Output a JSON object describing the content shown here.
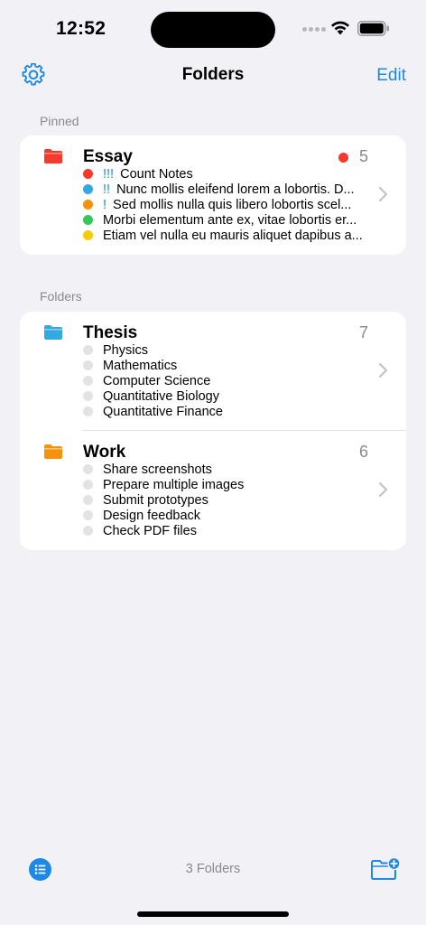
{
  "status": {
    "time": "12:52"
  },
  "nav": {
    "title": "Folders",
    "edit_label": "Edit"
  },
  "sections": {
    "pinned_label": "Pinned",
    "folders_label": "Folders"
  },
  "colors": {
    "accent": "#1E88E5",
    "red": "#F5392C",
    "blue": "#33A9E0",
    "orange": "#F5930F",
    "green": "#34C759",
    "yellow": "#F6CC0A",
    "empty_dot": "#E3E3E6"
  },
  "pinned": {
    "name": "Essay",
    "count": "5",
    "icon_color": "#F5392C",
    "items": [
      {
        "priority": "!!!",
        "text": "Count Notes",
        "color": "#F5392C"
      },
      {
        "priority": "!!",
        "text": "Nunc mollis eleifend lorem a lobortis. D...",
        "color": "#33A9E0"
      },
      {
        "priority": "!",
        "text": "Sed mollis nulla quis libero lobortis scel...",
        "color": "#F5930F"
      },
      {
        "priority": "",
        "text": "Morbi elementum ante ex, vitae lobortis er...",
        "color": "#34C759"
      },
      {
        "priority": "",
        "text": "Etiam vel nulla eu mauris aliquet dapibus a...",
        "color": "#F6CC0A"
      }
    ]
  },
  "folders": [
    {
      "name": "Thesis",
      "count": "7",
      "icon_color": "#33A9E0",
      "items": [
        {
          "priority": "",
          "text": "Physics",
          "color": "#E3E3E6"
        },
        {
          "priority": "",
          "text": "Mathematics",
          "color": "#E3E3E6"
        },
        {
          "priority": "",
          "text": "Computer Science",
          "color": "#E3E3E6"
        },
        {
          "priority": "",
          "text": "Quantitative Biology",
          "color": "#E3E3E6"
        },
        {
          "priority": "",
          "text": "Quantitative Finance",
          "color": "#E3E3E6"
        }
      ]
    },
    {
      "name": "Work",
      "count": "6",
      "icon_color": "#F5930F",
      "items": [
        {
          "priority": "",
          "text": "Share screenshots",
          "color": "#E3E3E6"
        },
        {
          "priority": "",
          "text": "Prepare multiple images",
          "color": "#E3E3E6"
        },
        {
          "priority": "",
          "text": "Submit prototypes",
          "color": "#E3E3E6"
        },
        {
          "priority": "",
          "text": "Design feedback",
          "color": "#E3E3E6"
        },
        {
          "priority": "",
          "text": "Check PDF files",
          "color": "#E3E3E6"
        }
      ]
    }
  ],
  "footer": {
    "count_label": "3 Folders"
  },
  "icons": {
    "settings": "gear-icon",
    "list": "list-icon",
    "new_folder": "new-folder-icon",
    "chevron": "chevron-right-icon"
  }
}
